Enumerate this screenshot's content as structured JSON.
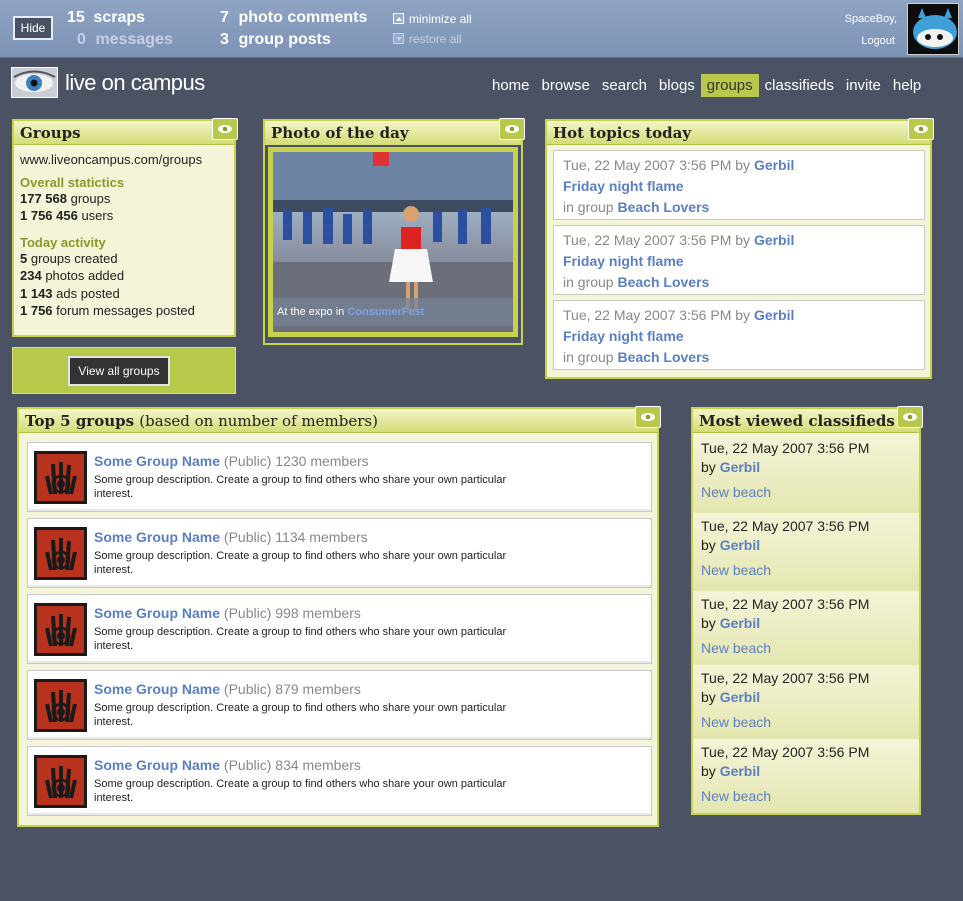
{
  "topbar": {
    "hide_label": "Hide",
    "scraps": {
      "count": "15",
      "label": "scraps"
    },
    "messages": {
      "count": "0",
      "label": "messages"
    },
    "photo_comments": {
      "count": "7",
      "label": "photo comments"
    },
    "group_posts": {
      "count": "3",
      "label": "group posts"
    },
    "minimize_all": "minimize all",
    "restore_all": "restore all",
    "username": "SpaceBoy,",
    "logout": "Logout"
  },
  "brand": {
    "name": "live on campus"
  },
  "nav": {
    "items": [
      "home",
      "browse",
      "search",
      "blogs",
      "groups",
      "classifieds",
      "invite",
      "help"
    ],
    "active": "groups"
  },
  "groups_panel": {
    "title": "Groups",
    "url": "www.liveoncampus.com/groups",
    "overall_heading": "Overall statictics",
    "overall": [
      {
        "num": "177 568",
        "label": " groups"
      },
      {
        "num": "1 756 456",
        "label": " users"
      }
    ],
    "today_heading": "Today activity",
    "today": [
      {
        "num": "5",
        "label": " groups created"
      },
      {
        "num": "234",
        "label": " photos added"
      },
      {
        "num": "1 143",
        "label": " ads posted"
      },
      {
        "num": "1 756",
        "label": " forum messages posted"
      }
    ],
    "view_all": "View all groups"
  },
  "photo_panel": {
    "title": "Photo of the day",
    "caption_prefix": "At the expo in ",
    "caption_link": "ConsumerFest"
  },
  "hot_topics": {
    "title": "Hot topics today",
    "items": [
      {
        "date": "Tue, 22 May 2007 3:56 PM",
        "by": "by",
        "author": "Gerbil",
        "topic": "Friday night flame",
        "in_group": "in group",
        "group": "Beach Lovers"
      },
      {
        "date": "Tue, 22 May 2007 3:56 PM",
        "by": "by",
        "author": "Gerbil",
        "topic": "Friday night flame",
        "in_group": "in group",
        "group": "Beach Lovers"
      },
      {
        "date": "Tue, 22 May 2007 3:56 PM",
        "by": "by",
        "author": "Gerbil",
        "topic": "Friday night flame",
        "in_group": "in group",
        "group": "Beach Lovers"
      }
    ]
  },
  "top5": {
    "title": "Top 5 groups",
    "subtitle": "(based on number of members)",
    "items": [
      {
        "name": "Some Group Name",
        "visibility": "(Public)",
        "members": "1230 members",
        "desc": "Some group description. Create a group to find others who share your own particular interest."
      },
      {
        "name": "Some Group Name",
        "visibility": "(Public)",
        "members": "1134 members",
        "desc": "Some group description. Create a group to find others who share your own particular interest."
      },
      {
        "name": "Some Group Name",
        "visibility": "(Public)",
        "members": "998 members",
        "desc": "Some group description. Create a group to find others who share your own particular interest."
      },
      {
        "name": "Some Group Name",
        "visibility": "(Public)",
        "members": "879 members",
        "desc": "Some group description. Create a group to find others who share your own particular interest."
      },
      {
        "name": "Some Group Name",
        "visibility": "(Public)",
        "members": "834 members",
        "desc": "Some group description. Create a group to find others who share your own particular interest."
      }
    ]
  },
  "classifieds": {
    "title": "Most viewed classifieds",
    "items": [
      {
        "date": "Tue, 22 May 2007 3:56 PM",
        "by": "by",
        "author": "Gerbil",
        "title": "New beach"
      },
      {
        "date": "Tue, 22 May 2007 3:56 PM",
        "by": "by",
        "author": "Gerbil",
        "title": "New beach"
      },
      {
        "date": "Tue, 22 May 2007 3:56 PM",
        "by": "by",
        "author": "Gerbil",
        "title": "New beach"
      },
      {
        "date": "Tue, 22 May 2007 3:56 PM",
        "by": "by",
        "author": "Gerbil",
        "title": "New beach"
      },
      {
        "date": "Tue, 22 May 2007 3:56 PM",
        "by": "by",
        "author": "Gerbil",
        "title": "New beach"
      }
    ]
  },
  "icons": {
    "toggle": "eye-icon",
    "group": "spiral-hand-icon",
    "logo": "eye-photo-icon"
  }
}
